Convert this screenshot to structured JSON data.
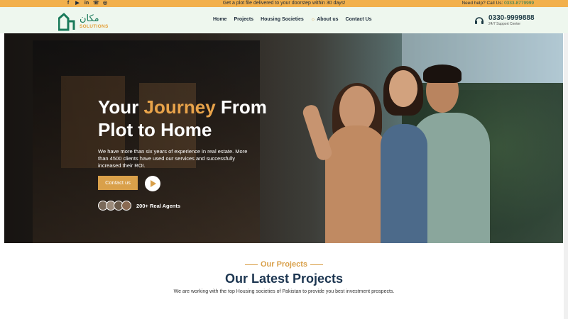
{
  "topbar": {
    "social_icons": [
      "facebook-icon",
      "youtube-icon",
      "linkedin-icon",
      "whatsapp-icon",
      "instagram-icon"
    ],
    "promo": "Get a plot file delivered to your doorstep within 30 days!",
    "help_label": "Need help? Call Us:",
    "help_phone": "0333-8779999"
  },
  "header": {
    "logo_urdu": "مکان",
    "logo_text": "SOLUTIONS",
    "nav": [
      "Home",
      "Projects",
      "Housing Societies",
      "About us",
      "Contact Us"
    ],
    "phone": "0330-9999888",
    "phone_sub": "24/7 Support Center"
  },
  "hero": {
    "title_part1": "Your ",
    "title_accent": "Journey",
    "title_part2": " From",
    "title_line2": "Plot to Home",
    "description": "We have more than six years of experience in real estate. More than 4500 clients have used our services and successfully increased their ROI.",
    "cta": "Contact us",
    "agents_label": "200+ Real Agents"
  },
  "projects": {
    "tag": "Our Projects",
    "title": "Our Latest Projects",
    "subtitle": "We are working with the top Housing societies of Pakistan to provide you best investment prospects."
  },
  "colors": {
    "accent": "#d9a04a",
    "topbar": "#f2b04c",
    "header_bg": "#eef7ee",
    "brand_green": "#1a7a5a",
    "heading": "#1c3550"
  }
}
